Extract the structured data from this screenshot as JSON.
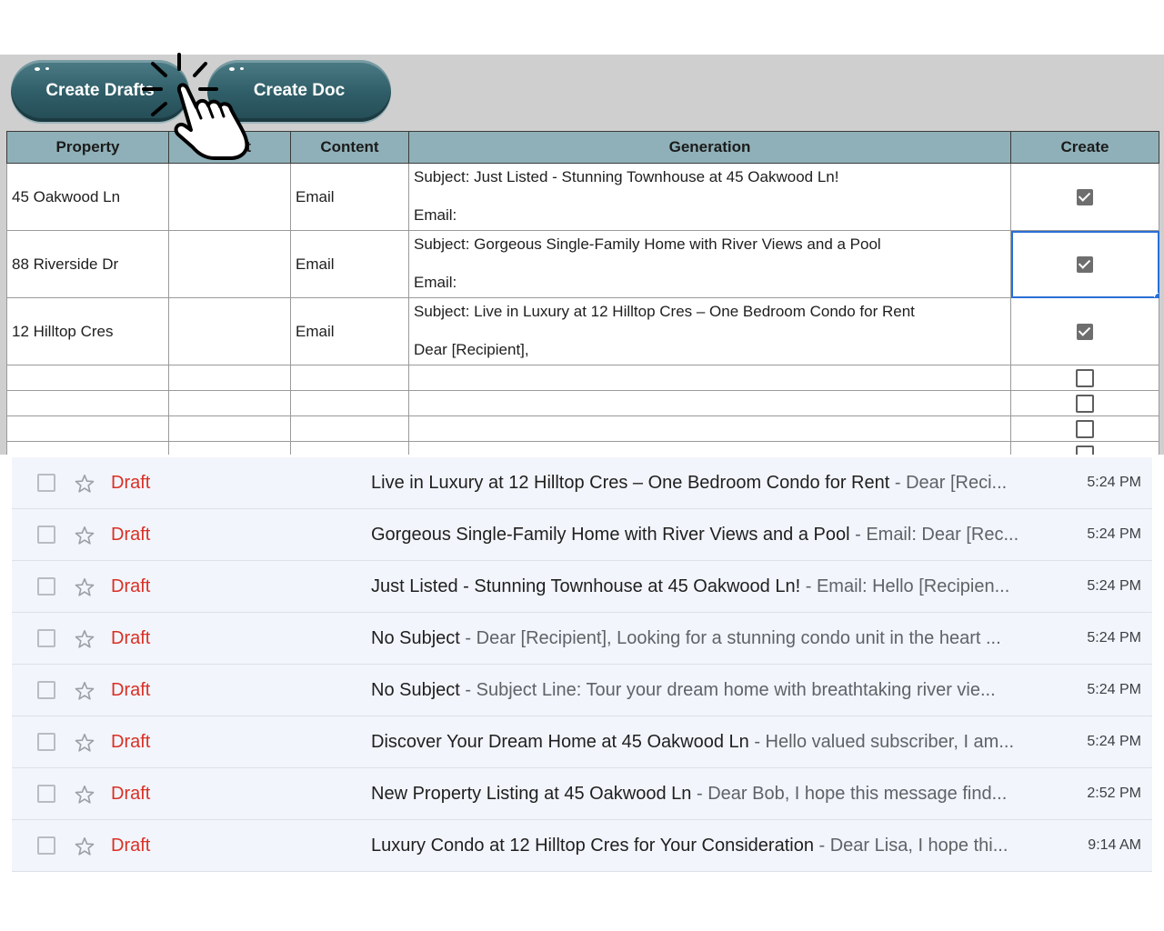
{
  "toolbar": {
    "create_drafts_label": "Create Drafts",
    "create_doc_label": "Create Doc"
  },
  "sheet": {
    "headers": {
      "property": "Property",
      "client": "Client",
      "content": "Content",
      "generation": "Generation",
      "create": "Create"
    },
    "rows": [
      {
        "property": "45 Oakwood Ln",
        "client": "",
        "content": "Email",
        "generation_subject": "Subject: Just Listed - Stunning Townhouse at 45 Oakwood Ln!",
        "generation_body": "Email:",
        "create_checked": true
      },
      {
        "property": "88 Riverside Dr",
        "client": "",
        "content": "Email",
        "generation_subject": "Subject: Gorgeous Single-Family Home with River Views and a Pool",
        "generation_body": "Email:",
        "create_checked": true
      },
      {
        "property": "12 Hilltop Cres",
        "client": "",
        "content": "Email",
        "generation_subject": "Subject: Live in Luxury at 12 Hilltop Cres – One Bedroom Condo for Rent",
        "generation_body": "Dear [Recipient],",
        "create_checked": true
      }
    ],
    "empty_rows_unchecked": 4
  },
  "gmail": {
    "rows": [
      {
        "status": "Draft",
        "subject": "Live in Luxury at 12 Hilltop Cres – One Bedroom Condo for Rent",
        "separator": " - ",
        "snippet": "Dear [Reci...",
        "time": "5:24 PM"
      },
      {
        "status": "Draft",
        "subject": "Gorgeous Single-Family Home with River Views and a Pool",
        "separator": " - ",
        "snippet": "Email: Dear [Rec...",
        "time": "5:24 PM"
      },
      {
        "status": "Draft",
        "subject": "Just Listed - Stunning Townhouse at 45 Oakwood Ln!",
        "separator": " - ",
        "snippet": "Email: Hello [Recipien...",
        "time": "5:24 PM"
      },
      {
        "status": "Draft",
        "subject": "No Subject",
        "separator": " - ",
        "snippet": "Dear [Recipient], Looking for a stunning condo unit in the heart ...",
        "time": "5:24 PM"
      },
      {
        "status": "Draft",
        "subject": "No Subject",
        "separator": " - ",
        "snippet": "Subject Line: Tour your dream home with breathtaking river vie...",
        "time": "5:24 PM"
      },
      {
        "status": "Draft",
        "subject": "Discover Your Dream Home at 45 Oakwood Ln",
        "separator": " - ",
        "snippet": "Hello valued subscriber, I am...",
        "time": "5:24 PM"
      },
      {
        "status": "Draft",
        "subject": "New Property Listing at 45 Oakwood Ln",
        "separator": " - ",
        "snippet": "Dear Bob, I hope this message find...",
        "time": "2:52 PM"
      },
      {
        "status": "Draft",
        "subject": "Luxury Condo at 12 Hilltop Cres for Your Consideration",
        "separator": " - ",
        "snippet": "Dear Lisa, I hope thi...",
        "time": "9:14 AM"
      }
    ]
  },
  "icons": {
    "cursor": "pointing-hand-click-icon",
    "checkbox": "checkbox-icon",
    "star": "star-outline-icon"
  }
}
